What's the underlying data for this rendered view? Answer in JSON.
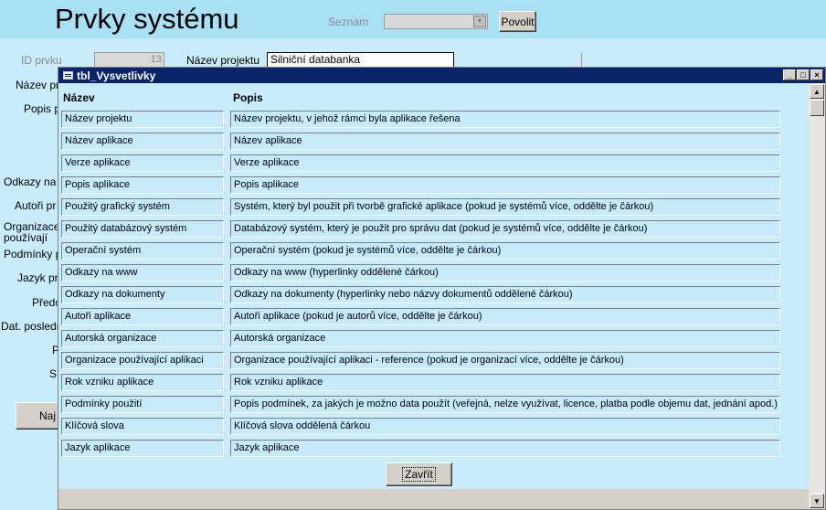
{
  "form": {
    "title": "Prvky systému",
    "seznam_label": "Seznam",
    "seznam_value": "",
    "povolit_label": "Povolit",
    "id_label": "ID prvku",
    "id_value": "13",
    "nazev_projektu_label": "Název projektu",
    "nazev_projektu_value": "Silniční databanka",
    "left_labels": [
      "Název pr",
      "Popis p",
      "Odkazy na w",
      "Autoři pr",
      "Organizace",
      "používají",
      "Podmínky p",
      "Jazyk pr",
      "Předc",
      "Dat. posledn",
      "P",
      "S"
    ],
    "naj_button": "Naj"
  },
  "dialog": {
    "title": "tbl_Vysvetlivky",
    "header_nazev": "Název",
    "header_popis": "Popis",
    "rows": [
      {
        "nazev": "Název projektu",
        "popis": "Název projektu, v jehož rámci byla aplikace řešena"
      },
      {
        "nazev": "Název aplikace",
        "popis": "Název aplikace"
      },
      {
        "nazev": "Verze aplikace",
        "popis": "Verze aplikace"
      },
      {
        "nazev": "Popis aplikace",
        "popis": "Popis aplikace"
      },
      {
        "nazev": "Použitý grafický systém",
        "popis": "Systém, který byl použit při tvorbě grafické aplikace (pokud je systémů více, oddělte je čárkou)"
      },
      {
        "nazev": "Použitý databázový systém",
        "popis": "Databázový systém, který je použit pro správu dat (pokud je systémů více, oddělte je čárkou)"
      },
      {
        "nazev": "Operační systém",
        "popis": "Operační systém (pokud je systémů více, oddělte je čárkou)"
      },
      {
        "nazev": "Odkazy na www",
        "popis": "Odkazy na www  (hyperlinky oddělené čárkou)"
      },
      {
        "nazev": "Odkazy na dokumenty",
        "popis": "Odkazy na dokumenty (hyperlinky nebo názvy dokumentů oddělené čárkou)"
      },
      {
        "nazev": "Autoři aplikace",
        "popis": "Autoři aplikace (pokud je autorů více, oddělte je čárkou)"
      },
      {
        "nazev": "Autorská organizace",
        "popis": "Autorská organizace"
      },
      {
        "nazev": "Organizace používající aplikaci",
        "popis": "Organizace používající aplikaci - reference (pokud je organizací více, oddělte je čárkou)"
      },
      {
        "nazev": "Rok vzniku aplikace",
        "popis": "Rok vzniku aplikace"
      },
      {
        "nazev": "Podmínky použití",
        "popis": "Popis podmínek, za jakých je možno data použít (veřejná, nelze využívat, licence, platba podle objemu dat, jednání apod.)"
      },
      {
        "nazev": "Klíčová slova",
        "popis": "Klíčová slova oddělená čárkou"
      },
      {
        "nazev": "Jazyk aplikace",
        "popis": "Jazyk aplikace"
      }
    ],
    "zavrit_label": "Zavřít"
  }
}
